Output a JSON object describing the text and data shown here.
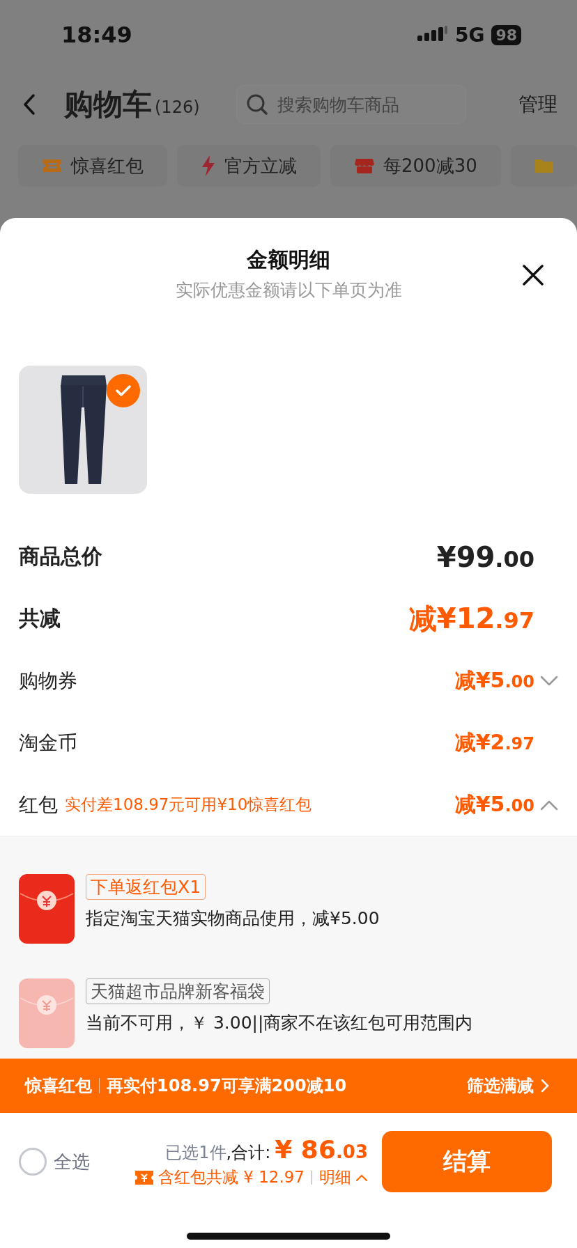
{
  "status_bar": {
    "time": "18:49",
    "network": "5G",
    "battery": "98"
  },
  "header": {
    "title": "购物车",
    "count": "(126)",
    "search_placeholder": "搜索购物车商品",
    "action": "管理"
  },
  "chips": [
    {
      "kind": "ticket",
      "label": "惊喜红包"
    },
    {
      "kind": "bolt",
      "label": "官方立减"
    },
    {
      "kind": "shop",
      "label": "每200减30"
    },
    {
      "kind": "folder"
    }
  ],
  "sheet": {
    "title": "金额明细",
    "subtitle": "实际优惠金额请以下单页为准",
    "product": {
      "selected": true
    },
    "rows": [
      {
        "kind": "total",
        "label": "商品总价",
        "yuan": "¥99",
        "cents": ".00"
      },
      {
        "kind": "discount_total",
        "label": "共减",
        "prefix": "减",
        "yuan": "¥12",
        "cents": ".97"
      },
      {
        "kind": "discount",
        "label": "购物券",
        "prefix": "减",
        "yuan": "¥5",
        "cents": ".00",
        "expanded": false
      },
      {
        "kind": "discount",
        "label": "淘金币",
        "prefix": "减",
        "yuan": "¥2",
        "cents": ".97"
      },
      {
        "kind": "discount",
        "label": "红包",
        "note": "实付差108.97元可用¥10惊喜红包",
        "prefix": "减",
        "yuan": "¥5",
        "cents": ".00",
        "expanded": true
      }
    ],
    "packets": [
      {
        "available": true,
        "tag": "下单返红包X1",
        "desc": "指定淘宝天猫实物商品使用，减¥5.00"
      },
      {
        "available": false,
        "tag": "天猫超市品牌新客福袋",
        "desc": "当前不可用，￥ 3.00||商家不在该红包可用范围内"
      }
    ]
  },
  "banner": {
    "title": "惊喜红包",
    "text": "再实付108.97可享满200减10",
    "link": "筛选满减"
  },
  "footer": {
    "select_all": {
      "label": "全选",
      "checked": false
    },
    "selected": "已选1件",
    "total_label": ",合计:",
    "yuan": "¥ 86",
    "cents": ".03",
    "saving": "含红包共减 ¥ 12.97",
    "detail": "明细",
    "checkout": "结算"
  }
}
